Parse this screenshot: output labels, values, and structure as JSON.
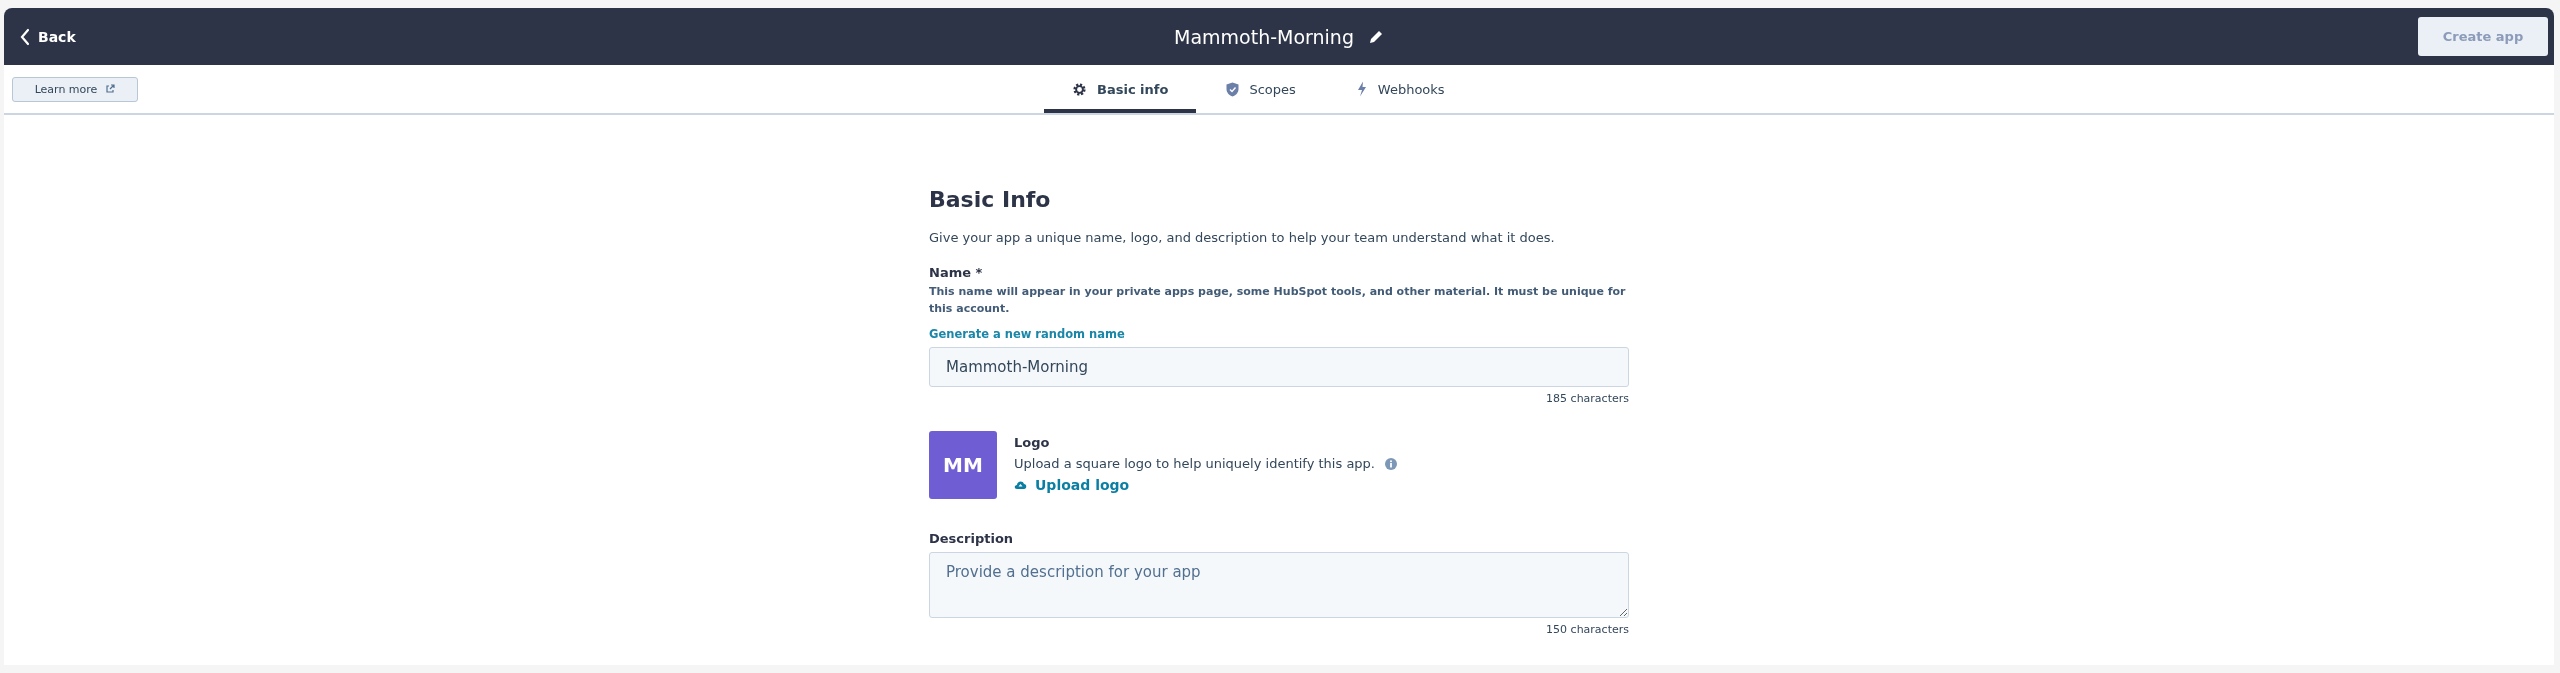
{
  "header": {
    "back": "Back",
    "title": "Mammoth-Morning",
    "create_button": {
      "label": "Create app",
      "disabled": true
    }
  },
  "learn_more": "Learn more",
  "tabs": [
    {
      "label": "Basic info",
      "selected": true
    },
    {
      "label": "Scopes",
      "selected": false
    },
    {
      "label": "Webhooks",
      "selected": false
    }
  ],
  "section": {
    "heading": "Basic Info",
    "intro": "Give your app a unique name, logo, and description to help your team understand what it does.",
    "name": {
      "label": "Name *",
      "help": "This name will appear in your private apps page, some HubSpot tools, and other material. It must be unique for this account.",
      "generate_link": "Generate a new random name",
      "value": "Mammoth-Morning",
      "counter": "185 characters"
    },
    "logo": {
      "initials": "MM",
      "label": "Logo",
      "help": "Upload a square logo to help uniquely identify this app.",
      "upload_link": "Upload logo"
    },
    "description": {
      "label": "Description",
      "placeholder": "Provide a description for your app",
      "counter": "150 characters"
    }
  }
}
